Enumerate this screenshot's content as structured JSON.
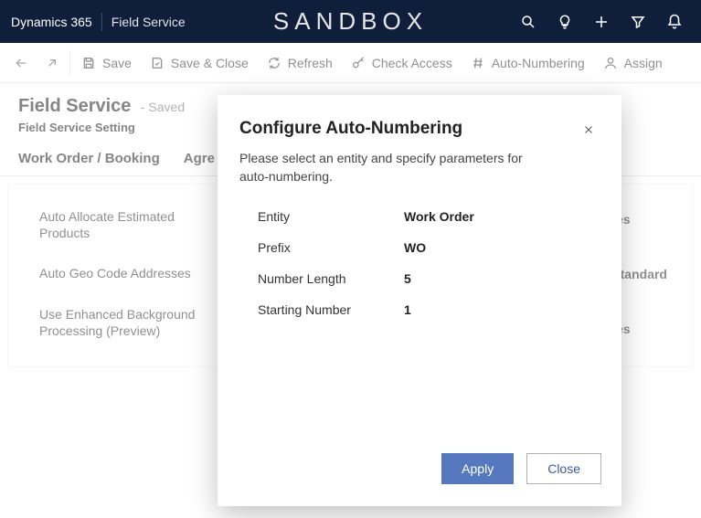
{
  "header": {
    "app": "Dynamics 365",
    "module": "Field Service",
    "env_badge": "SANDBOX"
  },
  "commands": {
    "save": "Save",
    "save_close": "Save & Close",
    "refresh": "Refresh",
    "check_access": "Check Access",
    "auto_numbering": "Auto-Numbering",
    "assign": "Assign"
  },
  "page": {
    "title": "Field Service",
    "status": "- Saved",
    "subtitle": "Field Service Setting",
    "tabs": [
      "Work Order / Booking",
      "Agre"
    ]
  },
  "form": {
    "left_labels": [
      "Auto Allocate Estimated Products",
      "Auto Geo Code Addresses",
      "Use Enhanced Background Processing (Preview)"
    ],
    "right_values": [
      "Yes",
      "/Standard",
      "Yes"
    ]
  },
  "dialog": {
    "title": "Configure Auto-Numbering",
    "description": "Please select an entity and specify parameters for auto-numbering.",
    "rows": [
      {
        "label": "Entity",
        "value": "Work Order"
      },
      {
        "label": "Prefix",
        "value": "WO"
      },
      {
        "label": "Number Length",
        "value": "5"
      },
      {
        "label": "Starting Number",
        "value": "1"
      }
    ],
    "apply": "Apply",
    "close": "Close"
  }
}
